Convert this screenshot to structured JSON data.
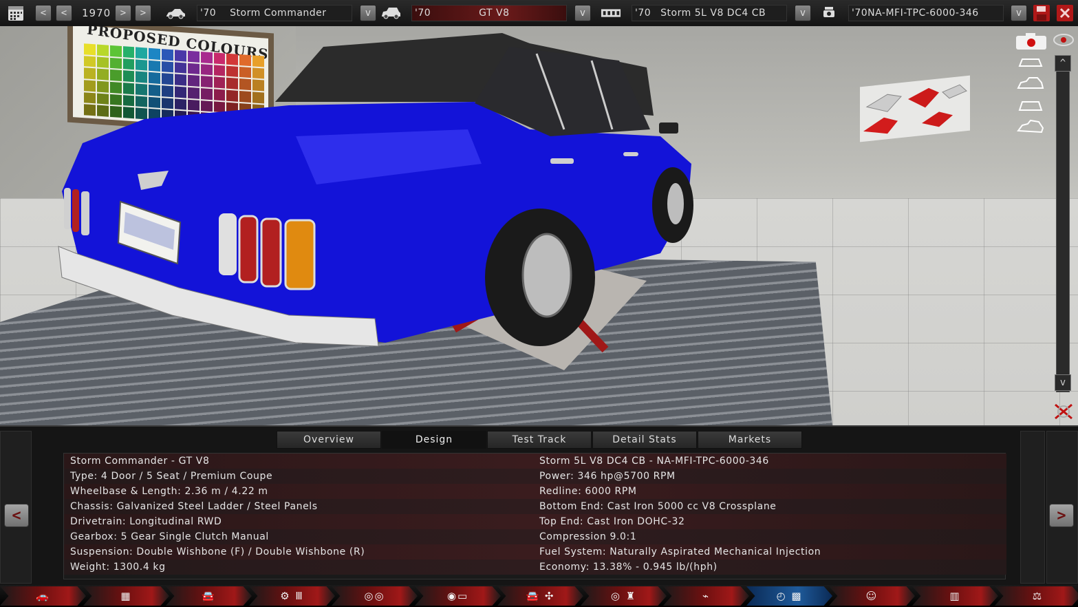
{
  "topbar": {
    "calendar_icon": "calendar-icon",
    "year": "1970",
    "prev_prev": "<",
    "prev": "<",
    "next": ">",
    "next_next": ">",
    "model_year": "'70",
    "model_name": "Storm Commander",
    "trim_year": "'70",
    "trim_name": "GT V8",
    "engine_year": "'70",
    "engine_name": "Storm 5L V8 DC4 CB",
    "variant_name": "'70NA-MFI-TPC-6000-346",
    "dropdown": "v"
  },
  "scene": {
    "board_title": "PROPOSED COLOURS",
    "scroll_up": "^",
    "scroll_down": "v",
    "close": "X",
    "swatch_colors": [
      "#e8df2a",
      "#b8d82a",
      "#5cc436",
      "#25b06a",
      "#1fa8a0",
      "#1c86c4",
      "#2b58b8",
      "#4a38a8",
      "#7a2e9e",
      "#a82a8e",
      "#c82a6c",
      "#d23838",
      "#e06a2a",
      "#e8a02a"
    ]
  },
  "tabs": [
    {
      "label": "Overview"
    },
    {
      "label": "Design"
    },
    {
      "label": "Test Track"
    },
    {
      "label": "Detail Stats"
    },
    {
      "label": "Markets"
    }
  ],
  "info": {
    "left": [
      "Storm Commander - GT V8",
      "Type: 4 Door / 5 Seat / Premium Coupe",
      "Wheelbase & Length: 2.36 m / 4.22 m",
      "Chassis: Galvanized Steel Ladder / Steel Panels",
      "Drivetrain: Longitudinal RWD",
      "Gearbox: 5 Gear Single Clutch Manual",
      "Suspension: Double Wishbone (F) / Double Wishbone (R)",
      "Weight: 1300.4 kg"
    ],
    "right": [
      "Storm 5L V8 DC4 CB - NA-MFI-TPC-6000-346",
      "Power: 346 hp@5700 RPM",
      "Redline: 6000 RPM",
      "Bottom End: Cast Iron 5000 cc V8 Crossplane",
      "Top End: Cast Iron DOHC-32",
      "Compression 9.0:1",
      "Fuel System: Naturally Aspirated Mechanical Injection",
      "Economy: 13.38% - 0.945 lb/(hph)"
    ],
    "prev_arrow": "<",
    "next_arrow": ">"
  },
  "footer": {
    "steps": [
      {
        "icon": "car-icon",
        "glyph": "🚗"
      },
      {
        "icon": "chassis-icon",
        "glyph": "▦"
      },
      {
        "icon": "car-body-icon",
        "glyph": "🚘"
      },
      {
        "icon": "gearbox-icon",
        "glyph": "⚙ Ⅲ"
      },
      {
        "icon": "wheels-icon",
        "glyph": "◎◎"
      },
      {
        "icon": "engine-icon",
        "glyph": "◉▭"
      },
      {
        "icon": "body-design-icon",
        "glyph": "🚘 ✣"
      },
      {
        "icon": "interior-icon",
        "glyph": "◎ ♜"
      },
      {
        "icon": "suspension-icon",
        "glyph": "⌁"
      },
      {
        "icon": "test-drive-icon",
        "glyph": "◴ ▩"
      },
      {
        "icon": "engineering-icon",
        "glyph": "☺"
      },
      {
        "icon": "factory-icon",
        "glyph": "▥"
      },
      {
        "icon": "balance-icon",
        "glyph": "⚖"
      }
    ]
  }
}
